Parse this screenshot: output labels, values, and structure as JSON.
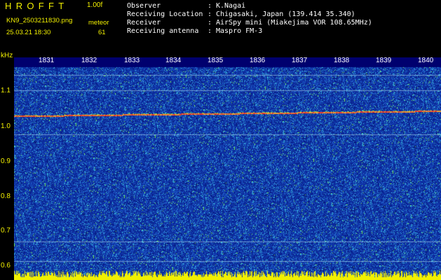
{
  "app": {
    "title": "HROFFT",
    "version": "1.00f",
    "filename": "KN9_2503211830.png",
    "datetime": "25.03.21 18:30",
    "meteor_label": "meteor",
    "meteor_count": "61"
  },
  "info": {
    "rows": [
      {
        "label": "Observer",
        "value": "K.Nagai"
      },
      {
        "label": "Receiving Location",
        "value": "Chigasaki, Japan (139.414 35.340)"
      },
      {
        "label": "Receiver",
        "value": "AirSpy mini (Miakejima VOR 108.65MHz)"
      },
      {
        "label": "Receiving antenna",
        "value": "Maspro FM-3"
      }
    ]
  },
  "y_axis": {
    "unit": "kHz",
    "ticks": [
      "1.1",
      "1.0",
      "0.9",
      "0.8",
      "0.7",
      "0.6"
    ],
    "min": 0.585,
    "max": 1.17
  },
  "x_axis": {
    "ticks": [
      "1831",
      "1832",
      "1833",
      "1834",
      "1835",
      "1836",
      "1837",
      "1838",
      "1839",
      "1840"
    ]
  },
  "colors": {
    "background": "#000000",
    "label_yellow": "#f2f000",
    "waterfall_base": "#0c2a9c",
    "noise_cyan": "#3fd0e0",
    "noise_green": "#7cf25a",
    "carrier_red": "#f23a2a"
  },
  "signals": {
    "carrier_khz": 1.032,
    "horizontal_lines_khz": [
      1.148,
      1.105,
      0.978,
      0.675,
      0.618
    ]
  }
}
